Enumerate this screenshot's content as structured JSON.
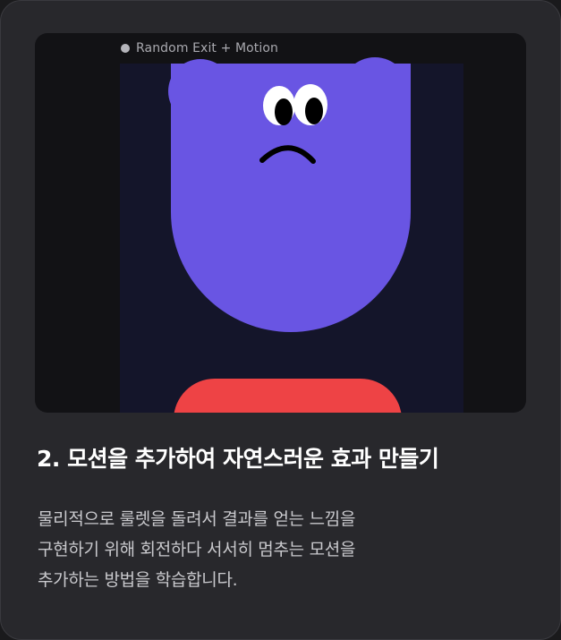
{
  "card": {
    "preview_label": "Random Exit + Motion",
    "title": "2. 모션을 추가하여 자연스러운 효과 만들기",
    "description_lines": [
      "물리적으로 룰렛을 돌려서 결과를 얻는 느낌을",
      "구현하기 위해 회전하다 서서히 멈추는 모션을",
      "추가하는 방법을 학습합니다."
    ]
  },
  "colors": {
    "card_background": "#28282c",
    "preview_background": "#121215",
    "character": "#6955e3",
    "roulette": "#ee4345"
  }
}
